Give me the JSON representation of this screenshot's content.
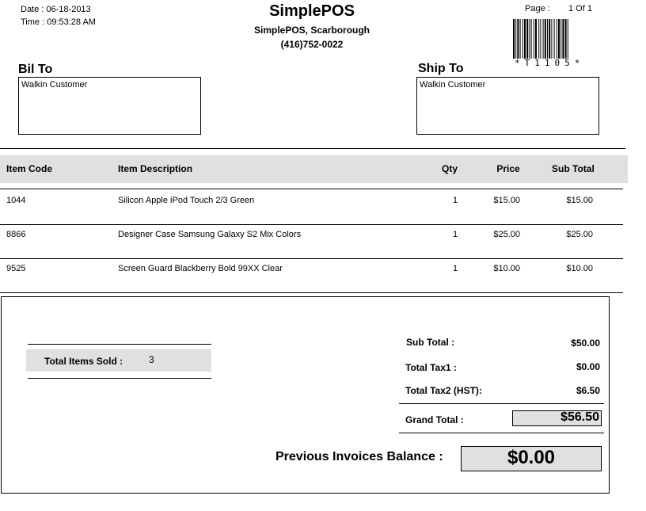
{
  "header": {
    "date_label": "Date : 06-18-2013",
    "time_label": "Time : 09:53:28 AM",
    "company": "SimplePOS",
    "store_line": "SimplePOS, Scarborough",
    "phone": "(416)752-0022",
    "page_label": "Page :",
    "page_value": "1 Of 1",
    "barcode_text": "*T1105*"
  },
  "bill_to": {
    "label": "Bil To",
    "name": "Walkin Customer"
  },
  "ship_to": {
    "label": "Ship To",
    "name": "Walkin Customer"
  },
  "table": {
    "headers": {
      "code": "Item Code",
      "description": "Item Description",
      "qty": "Qty",
      "price": "Price",
      "subtotal": "Sub Total"
    },
    "rows": [
      {
        "code": "1044",
        "description": "Silicon Apple iPod Touch 2/3 Green",
        "qty": "1",
        "price": "$15.00",
        "subtotal": "$15.00"
      },
      {
        "code": "8866",
        "description": "Designer Case Samsung Galaxy S2 Mix Colors",
        "qty": "1",
        "price": "$25.00",
        "subtotal": "$25.00"
      },
      {
        "code": "9525",
        "description": "Screen Guard Blackberry Bold 99XX  Clear",
        "qty": "1",
        "price": "$10.00",
        "subtotal": "$10.00"
      }
    ]
  },
  "summary": {
    "items_sold_label": "Total Items Sold :",
    "items_sold_value": "3",
    "subtotal_label": "Sub Total :",
    "subtotal_value": "$50.00",
    "tax1_label": "Total Tax1 :",
    "tax1_value": "$0.00",
    "tax2_label": "Total Tax2 (HST):",
    "tax2_value": "$6.50",
    "grand_label": "Grand Total :",
    "grand_value": "$56.50",
    "prev_balance_label": "Previous Invoices Balance :",
    "prev_balance_value": "$0.00"
  }
}
